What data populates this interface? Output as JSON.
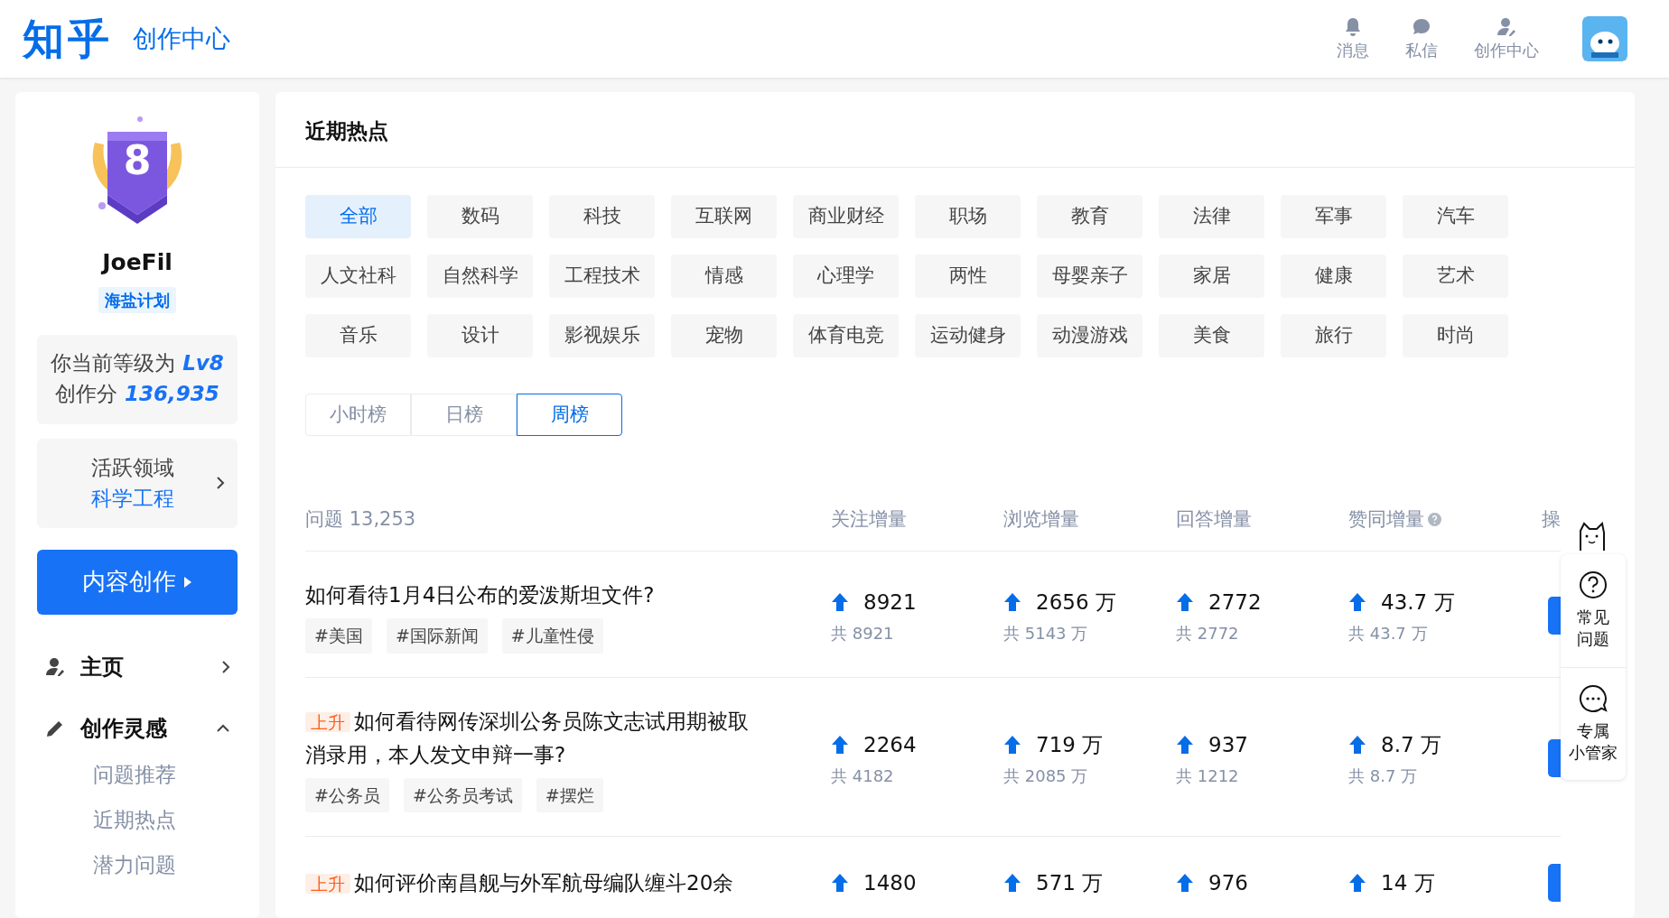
{
  "header": {
    "logo": "知乎",
    "title": "创作中心",
    "nav": [
      {
        "label": "消息",
        "kind": "bell"
      },
      {
        "label": "私信",
        "kind": "chat"
      },
      {
        "label": "创作中心",
        "kind": "user"
      }
    ]
  },
  "profile": {
    "level_badge": "8",
    "name": "JoeFil",
    "tag": "海盐计划",
    "level_label": "你当前等级为",
    "level_value": "Lv8",
    "score_label": "创作分",
    "score_value": "136,935",
    "domain_label": "活跃领域",
    "domain_value": "科学工程",
    "create_button": "内容创作"
  },
  "menu": [
    {
      "label": "主页",
      "kind": "home",
      "expanded": false
    },
    {
      "label": "创作灵感",
      "kind": "pen",
      "expanded": true,
      "children": [
        {
          "label": "问题推荐"
        },
        {
          "label": "近期热点"
        },
        {
          "label": "潜力问题"
        }
      ]
    }
  ],
  "panel": {
    "title": "近期热点",
    "categories": [
      {
        "label": "全部",
        "selected": true
      },
      {
        "label": "数码",
        "selected": false
      },
      {
        "label": "科技",
        "selected": false
      },
      {
        "label": "互联网",
        "selected": false
      },
      {
        "label": "商业财经",
        "selected": false
      },
      {
        "label": "职场",
        "selected": false
      },
      {
        "label": "教育",
        "selected": false
      },
      {
        "label": "法律",
        "selected": false
      },
      {
        "label": "军事",
        "selected": false
      },
      {
        "label": "汽车",
        "selected": false
      },
      {
        "label": "人文社科",
        "selected": false
      },
      {
        "label": "自然科学",
        "selected": false
      },
      {
        "label": "工程技术",
        "selected": false
      },
      {
        "label": "情感",
        "selected": false
      },
      {
        "label": "心理学",
        "selected": false
      },
      {
        "label": "两性",
        "selected": false
      },
      {
        "label": "母婴亲子",
        "selected": false
      },
      {
        "label": "家居",
        "selected": false
      },
      {
        "label": "健康",
        "selected": false
      },
      {
        "label": "艺术",
        "selected": false
      },
      {
        "label": "音乐",
        "selected": false
      },
      {
        "label": "设计",
        "selected": false
      },
      {
        "label": "影视娱乐",
        "selected": false
      },
      {
        "label": "宠物",
        "selected": false
      },
      {
        "label": "体育电竞",
        "selected": false
      },
      {
        "label": "运动健身",
        "selected": false
      },
      {
        "label": "动漫游戏",
        "selected": false
      },
      {
        "label": "美食",
        "selected": false
      },
      {
        "label": "旅行",
        "selected": false
      },
      {
        "label": "时尚",
        "selected": false
      }
    ],
    "ranges": [
      {
        "label": "小时榜",
        "selected": false
      },
      {
        "label": "日榜",
        "selected": false
      },
      {
        "label": "周榜",
        "selected": true
      }
    ],
    "table": {
      "columns": [
        {
          "label": "问题 13,253",
          "help": false
        },
        {
          "label": "关注增量",
          "help": false
        },
        {
          "label": "浏览增量",
          "help": false
        },
        {
          "label": "回答增量",
          "help": false
        },
        {
          "label": "赞同增量",
          "help": true
        },
        {
          "label": "操",
          "help": false
        }
      ],
      "rows": [
        {
          "title": "如何看待1月4日公布的爱泼斯坦文件?",
          "tags": [
            "#美国",
            "#国际新闻",
            "#儿童性侵"
          ],
          "stats": [
            {
              "value": "8921",
              "total": "共 8921"
            },
            {
              "value": "2656 万",
              "total": "共 5143 万"
            },
            {
              "value": "2772",
              "total": "共 2772"
            },
            {
              "value": "43.7 万",
              "total": "共 43.7 万"
            }
          ]
        },
        {
          "badge": "上升",
          "title": "如何看待网传深圳公务员陈文志试用期被取消录用，本人发文申辩一事?",
          "tags": [
            "#公务员",
            "#公务员考试",
            "#摆烂"
          ],
          "stats": [
            {
              "value": "2264",
              "total": "共 4182"
            },
            {
              "value": "719 万",
              "total": "共 2085 万"
            },
            {
              "value": "937",
              "total": "共 1212"
            },
            {
              "value": "8.7 万",
              "total": "共 8.7 万"
            }
          ]
        },
        {
          "badge": "上升",
          "title": "如何评价南昌舰与外军航母编队缠斗20余",
          "tags": [],
          "stats": [
            {
              "value": "1480"
            },
            {
              "value": "571 万"
            },
            {
              "value": "976"
            },
            {
              "value": "14 万"
            }
          ]
        }
      ]
    }
  },
  "float_panel": [
    {
      "kind": "help",
      "lines": [
        "常见",
        "问题"
      ]
    },
    {
      "kind": "chat",
      "lines": [
        "专属",
        "小管家"
      ]
    }
  ]
}
